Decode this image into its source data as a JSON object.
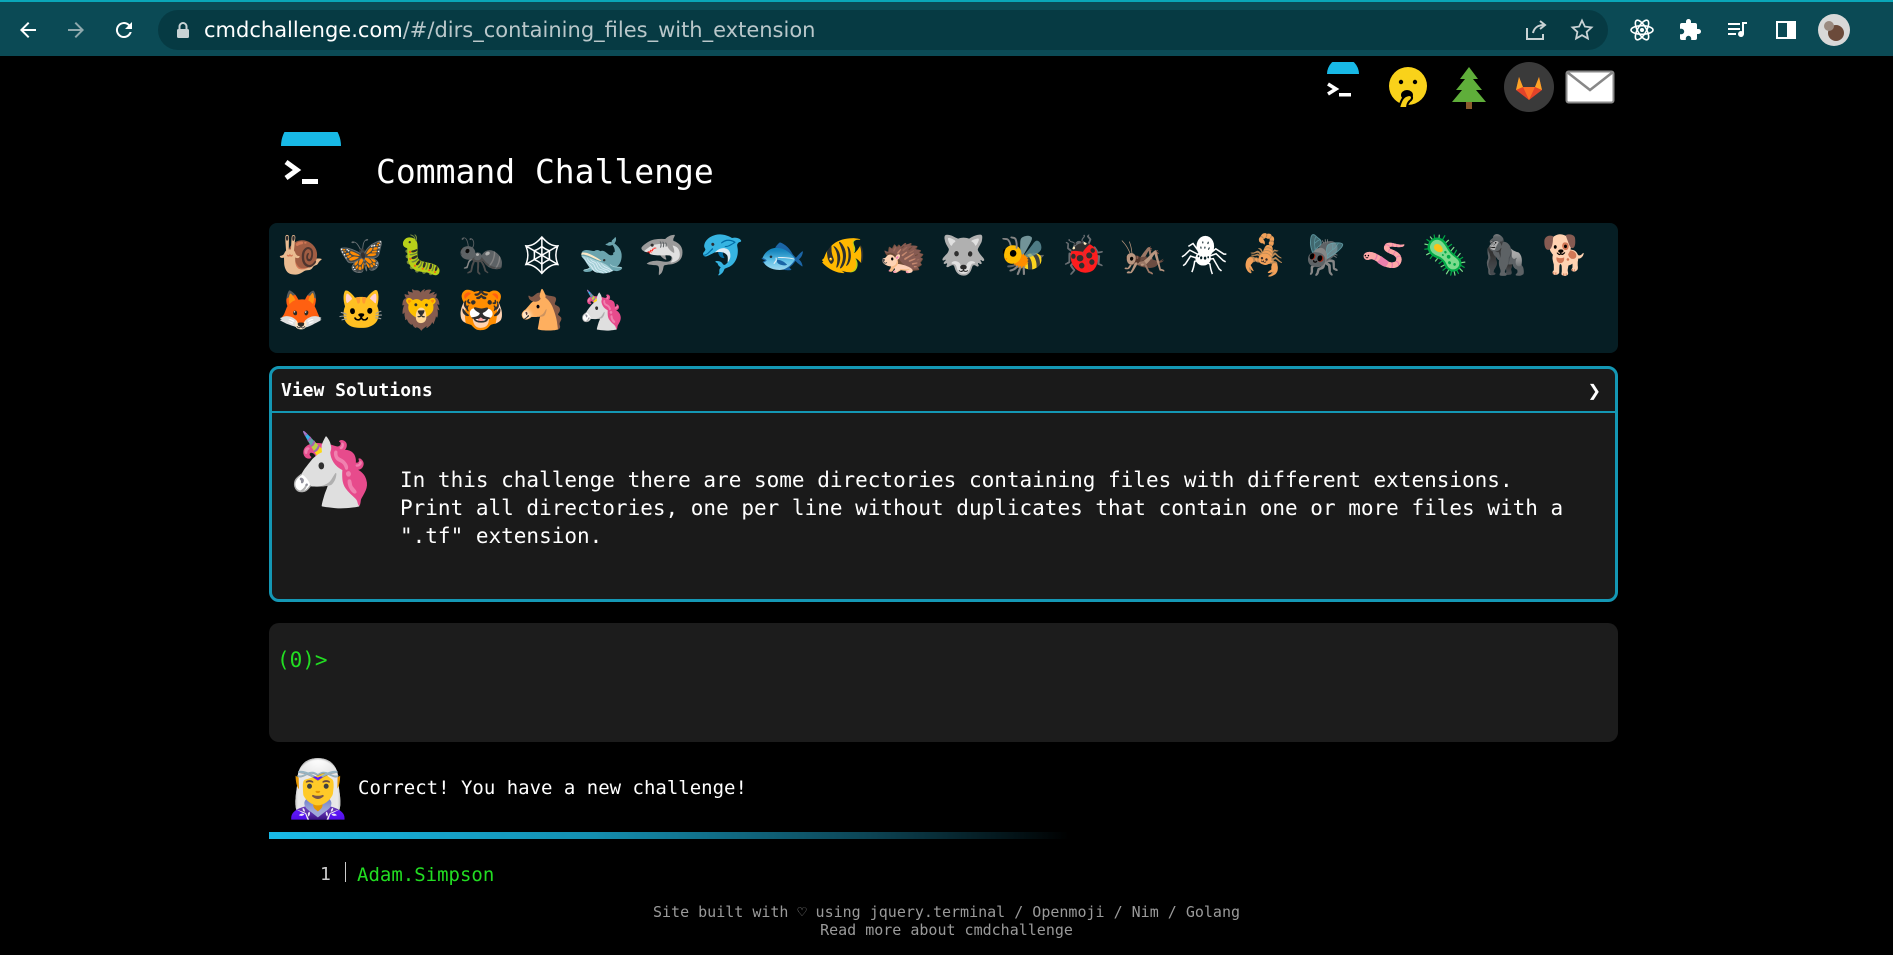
{
  "browser": {
    "url_host": "cmdchallenge.com",
    "url_path": "/#/dirs_containing_files_with_extension",
    "back_icon": "arrow-left-icon",
    "forward_icon": "arrow-right-icon",
    "reload_icon": "reload-icon",
    "lock_icon": "lock-icon",
    "share_icon": "share-icon",
    "bookmark_icon": "star-icon",
    "extensions": [
      "react-icon",
      "puzzle-icon",
      "media-queue-icon",
      "sidepanel-icon",
      "profile-avatar"
    ]
  },
  "top_links": [
    "cmdchallenge-icon",
    "hand-over-mouth-emoji",
    "tree-emoji",
    "gitlab-icon",
    "envelope-icon"
  ],
  "header": {
    "title": "Command Challenge"
  },
  "animals": {
    "row1": [
      "🐌",
      "🦋",
      "🐛",
      "🐜",
      "🕸",
      "🐋",
      "🦈",
      "🐬",
      "🐟",
      "🐠",
      "🦔",
      "🐺",
      "🐝",
      "🐞",
      "🦗",
      "🕷",
      "🦂",
      "🪰",
      "🪱",
      "🦠",
      "🦍",
      "🐕"
    ],
    "row2": [
      "🦊",
      "🐱",
      "🦁",
      "🐯",
      "🐴",
      "🦄"
    ]
  },
  "solutions": {
    "toggle_label": "View Solutions",
    "chevron": "❯",
    "icon": "🦄",
    "description": "In this challenge there are some directories containing files with different extensions.\nPrint all directories, one per line without duplicates that contain one or more files with a\n\".tf\" extension."
  },
  "terminal": {
    "prompt": "(0)>"
  },
  "message": {
    "icon": "🧝‍♀️",
    "text": "Correct! You have a new challenge!"
  },
  "leaderboard": [
    {
      "rank": "1",
      "name": "Adam.Simpson"
    }
  ],
  "footer": {
    "line1": "Site built with ♡ using jquery.terminal / Openmoji / Nim / Golang",
    "line2": "Read more about cmdchallenge"
  }
}
